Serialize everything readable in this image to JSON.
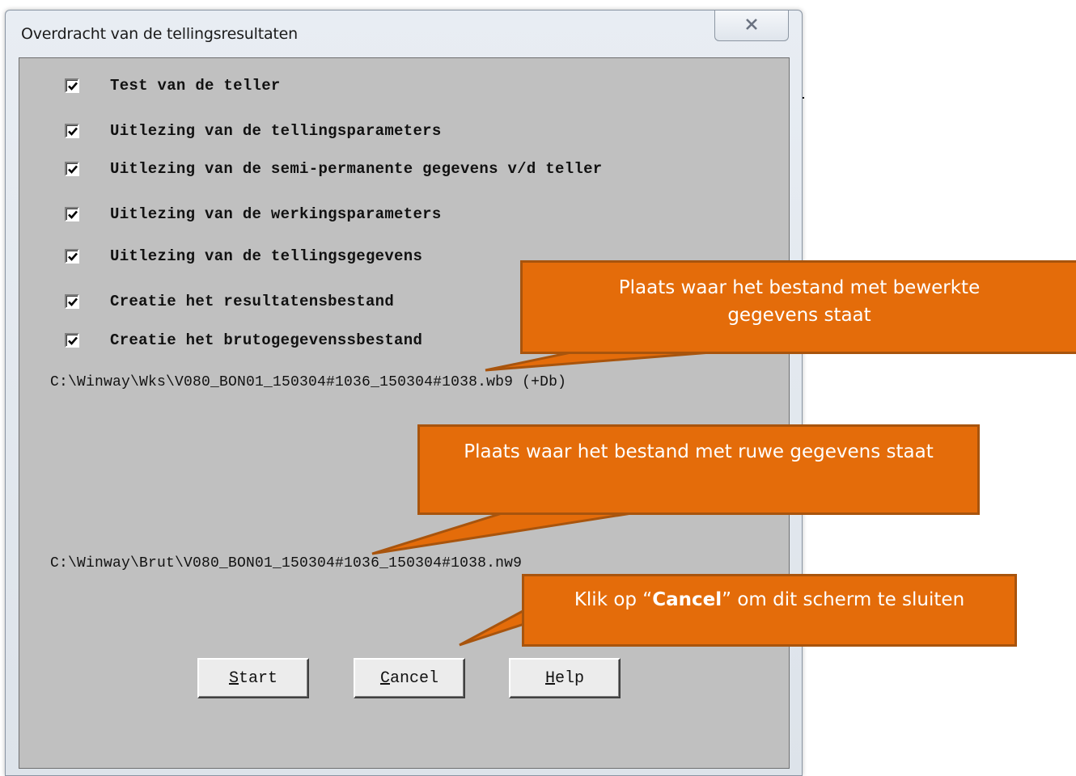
{
  "window": {
    "title": "Overdracht van de tellingsresultaten",
    "close_glyph": "✕"
  },
  "checkboxes": [
    {
      "label": "Test van de teller",
      "checked": true
    },
    {
      "label": "Uitlezing van de tellingsparameters",
      "checked": true
    },
    {
      "label": "Uitlezing van de semi-permanente gegevens v/d teller",
      "checked": true
    },
    {
      "label": "Uitlezing van de werkingsparameters",
      "checked": true
    },
    {
      "label": "Uitlezing van de tellingsgegevens",
      "checked": true
    },
    {
      "label": "Creatie het resultatensbestand",
      "checked": true
    },
    {
      "label": "Creatie het brutogegevenssbestand",
      "checked": true
    }
  ],
  "paths": {
    "processed_file": "C:\\Winway\\Wks\\V080_BON01_150304#1036_150304#1038.wb9 (+Db)",
    "raw_file": "C:\\Winway\\Brut\\V080_BON01_150304#1036_150304#1038.nw9"
  },
  "buttons": {
    "start": {
      "mnemonic": "S",
      "rest": "tart"
    },
    "cancel": {
      "mnemonic": "C",
      "rest": "ancel"
    },
    "help": {
      "mnemonic": "H",
      "rest": "elp"
    }
  },
  "callouts": {
    "processed": "Plaats waar het bestand met bewerkte gegevens staat",
    "raw": "Plaats waar het bestand met ruwe gegevens staat",
    "cancel_prefix": "Klik op “",
    "cancel_bold": "Cancel",
    "cancel_suffix": "” om dit scherm te sluiten"
  },
  "colors": {
    "callout_fill": "#e46c0a",
    "callout_border": "#a8540d",
    "client_bg": "#c0c0c0"
  },
  "icons": {
    "checkbox_mark": "check-icon",
    "close": "close-icon"
  }
}
